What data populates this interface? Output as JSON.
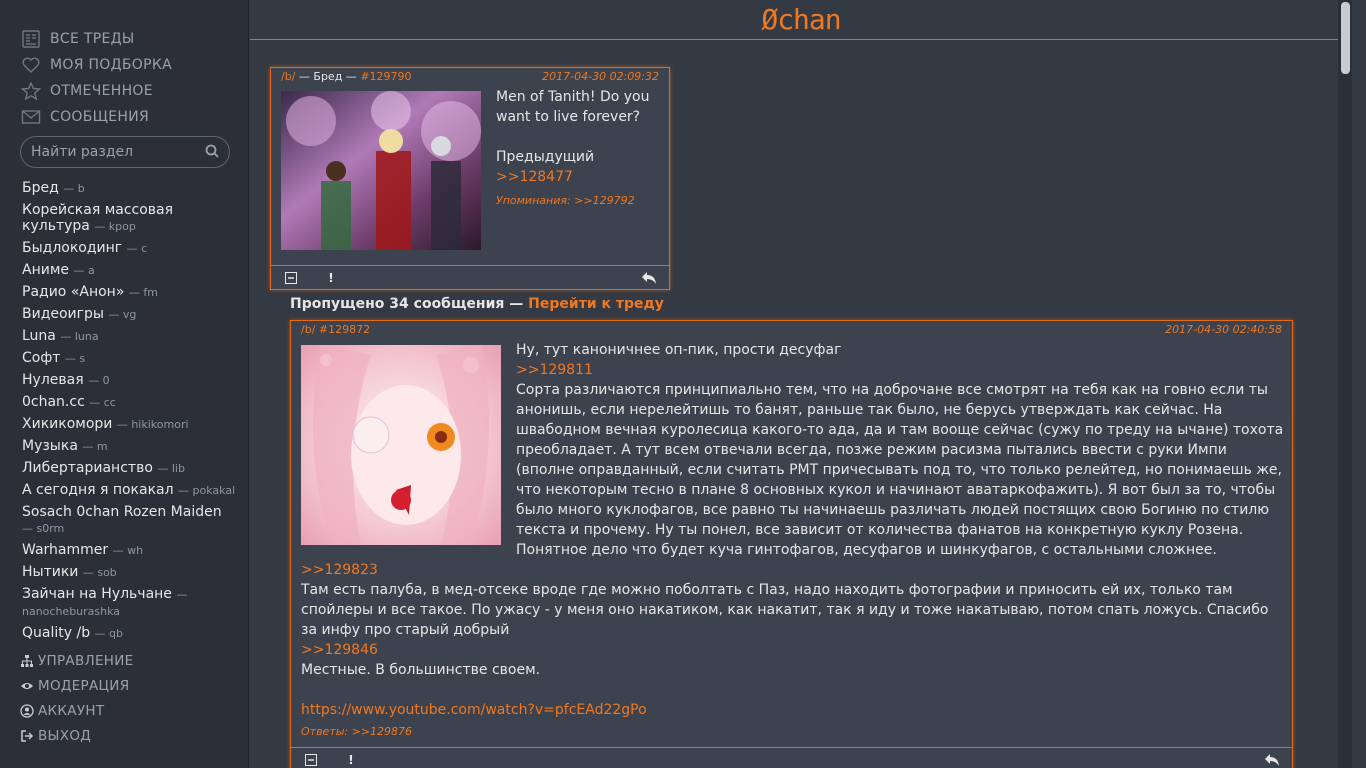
{
  "app": {
    "logo": "Øchan"
  },
  "topnav": [
    {
      "label": "ВСЕ ТРЕДЫ",
      "icon": "threads-icon"
    },
    {
      "label": "МОЯ ПОДБОРКА",
      "icon": "heart-icon"
    },
    {
      "label": "ОТМЕЧЕННОЕ",
      "icon": "star-icon"
    },
    {
      "label": "СООБЩЕНИЯ",
      "icon": "envelope-icon"
    }
  ],
  "search": {
    "placeholder": "Найти раздел"
  },
  "boards": [
    {
      "name": "Бред",
      "code": "— b"
    },
    {
      "name": "Корейская массовая культура",
      "code": "— kpop"
    },
    {
      "name": "Быдлокодинг",
      "code": "— c"
    },
    {
      "name": "Аниме",
      "code": "— a"
    },
    {
      "name": "Радио «Анон»",
      "code": "— fm"
    },
    {
      "name": "Видеоигры",
      "code": "— vg"
    },
    {
      "name": "Luna",
      "code": "— luna"
    },
    {
      "name": "Софт",
      "code": "— s"
    },
    {
      "name": "Нулевая",
      "code": "— 0"
    },
    {
      "name": "0chan.cc",
      "code": "— cc"
    },
    {
      "name": "Хикикомори",
      "code": "— hikikomori"
    },
    {
      "name": "Музыка",
      "code": "— m"
    },
    {
      "name": "Либертарианство",
      "code": "— lib"
    },
    {
      "name": "А сегодня я покакал",
      "code": "— pokakal"
    },
    {
      "name": "Sosach 0chan Rozen Maiden",
      "code": "— s0rm"
    },
    {
      "name": "Warhammer",
      "code": "— wh"
    },
    {
      "name": "Нытики",
      "code": "— sob"
    },
    {
      "name": "Зайчан на Нульчане",
      "code": "— nanocheburashka"
    },
    {
      "name": "Quality /b",
      "code": "— qb"
    }
  ],
  "botnav": [
    {
      "label": "УПРАВЛЕНИЕ",
      "icon": "sitemap-icon"
    },
    {
      "label": "МОДЕРАЦИЯ",
      "icon": "eye-icon"
    },
    {
      "label": "АККАУНТ",
      "icon": "user-icon"
    },
    {
      "label": "ВЫХОД",
      "icon": "sign-out-icon"
    }
  ],
  "op": {
    "board": "/b/",
    "sep1": " — ",
    "board_name": "Бред",
    "sep2": " — ",
    "num": "#129790",
    "date": "2017-04-30 02:09:32",
    "text1": "Men of Tanith! Do you want to live forever?",
    "text2": "Предыдущий",
    "ref": ">>128477",
    "mentions": "Упоминания: >>129792"
  },
  "skipped": {
    "text": "Пропущено 34 сообщения — ",
    "link": "Перейти к треду"
  },
  "reply": {
    "board": "/b/",
    "num": "#129872",
    "date": "2017-04-30 02:40:58",
    "l1": "Ну, тут каноничнее оп-пик, прости десуфаг",
    "ref1": ">>129811",
    "p1": "Сорта различаются принципиально тем, что на доброчане все смотрят на тебя как на говно если ты анонишь, если нерелейтишь то банят, раньше так было, не берусь утверждать как сейчас. На швабодном вечная куролесица какого-то ада, да и там вооще сейчас (сужу по треду на ычане) тохота преобладает. А тут всем отвечали всегда, позже режим расизма пытались ввести с руки Импи (вполне оправданный, если считать РМТ причесывать под то, что только релейтед, но понимаешь же, что некоторым тесно в плане 8 основных кукол и начинают аватаркофажить). Я вот был за то, чтобы было много куклофагов, все равно ты начинаешь различать людей постящих свою Богиню по стилю текста и прочему. Ну ты понел, все зависит от количества фанатов на конкретную куклу Розена. Понятное дело что будет куча гинтофагов, десуфагов и шинкуфагов, с остальными сложнее.",
    "ref2": ">>129823",
    "p2": "Там есть палуба, в мед-отсеке вроде где можно поболтать с Паз, надо находить фотографии и приносить ей их, только там спойлеры и все такое. По ужасу - у меня оно накатиком, как накатит, так я иду и тоже накатываю, потом спать ложусь. Спасибо за инфу про старый добрый",
    "ref3": ">>129846",
    "p3": "Местные. В большинстве своем.",
    "url": "https://www.youtube.com/watch?v=pfcEAd22gPo",
    "answers": "Ответы: >>129876"
  },
  "colors": {
    "accent": "#f07820",
    "bg": "#343a44",
    "sidebar": "#2b3038",
    "post": "#3c424e"
  }
}
